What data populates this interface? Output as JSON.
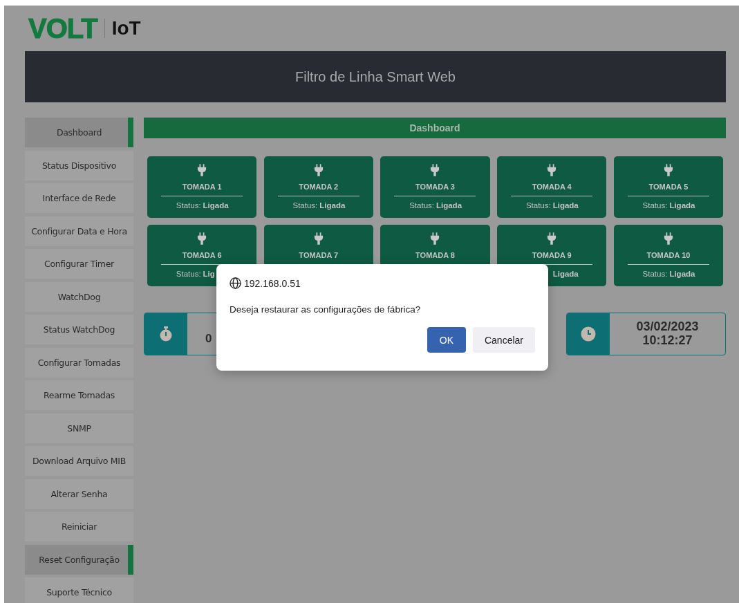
{
  "logo": {
    "brand": "VOLT",
    "product": "IoT"
  },
  "header": {
    "title": "Filtro de Linha Smart Web"
  },
  "sidebar": {
    "items": [
      {
        "label": "Dashboard",
        "selected": true
      },
      {
        "label": "Status Dispositivo",
        "selected": false
      },
      {
        "label": "Interface de Rede",
        "selected": false
      },
      {
        "label": "Configurar Data e Hora",
        "selected": false
      },
      {
        "label": "Configurar Timer",
        "selected": false
      },
      {
        "label": "WatchDog",
        "selected": false
      },
      {
        "label": "Status WatchDog",
        "selected": false
      },
      {
        "label": "Configurar Tomadas",
        "selected": false
      },
      {
        "label": "Rearme Tomadas",
        "selected": false
      },
      {
        "label": "SNMP",
        "selected": false
      },
      {
        "label": "Download Arquivo MIB",
        "selected": false
      },
      {
        "label": "Alterar Senha",
        "selected": false
      },
      {
        "label": "Reiniciar",
        "selected": false
      },
      {
        "label": "Reset Configuração",
        "selected": true
      },
      {
        "label": "Suporte Técnico",
        "selected": false
      }
    ]
  },
  "main": {
    "title": "Dashboard",
    "outlets": [
      {
        "name": "TOMADA 1",
        "status_label": "Status:",
        "status_value": "Ligada"
      },
      {
        "name": "TOMADA 2",
        "status_label": "Status:",
        "status_value": "Ligada"
      },
      {
        "name": "TOMADA 3",
        "status_label": "Status:",
        "status_value": "Ligada"
      },
      {
        "name": "TOMADA 4",
        "status_label": "Status:",
        "status_value": "Ligada"
      },
      {
        "name": "TOMADA 5",
        "status_label": "Status:",
        "status_value": "Ligada"
      },
      {
        "name": "TOMADA 6",
        "status_label": "Status:",
        "status_value": "Lig"
      },
      {
        "name": "TOMADA 7"
      },
      {
        "name": "TOMADA 8"
      },
      {
        "name": "TOMADA 9",
        "status_value": "Ligada"
      },
      {
        "name": "TOMADA 10",
        "status_label": "Status:",
        "status_value": "Ligada"
      }
    ],
    "info_cards": [
      {
        "kind": "timer",
        "lines": [
          "0"
        ]
      },
      {
        "kind": "clock",
        "lines": [
          "03/02/2023",
          "10:12:27"
        ]
      }
    ]
  },
  "dialog": {
    "origin": "192.168.0.51",
    "message": "Deseja restaurar as configurações de fábrica?",
    "buttons": [
      {
        "label": "OK",
        "kind": "primary"
      },
      {
        "label": "Cancelar",
        "kind": "secondary"
      }
    ]
  }
}
